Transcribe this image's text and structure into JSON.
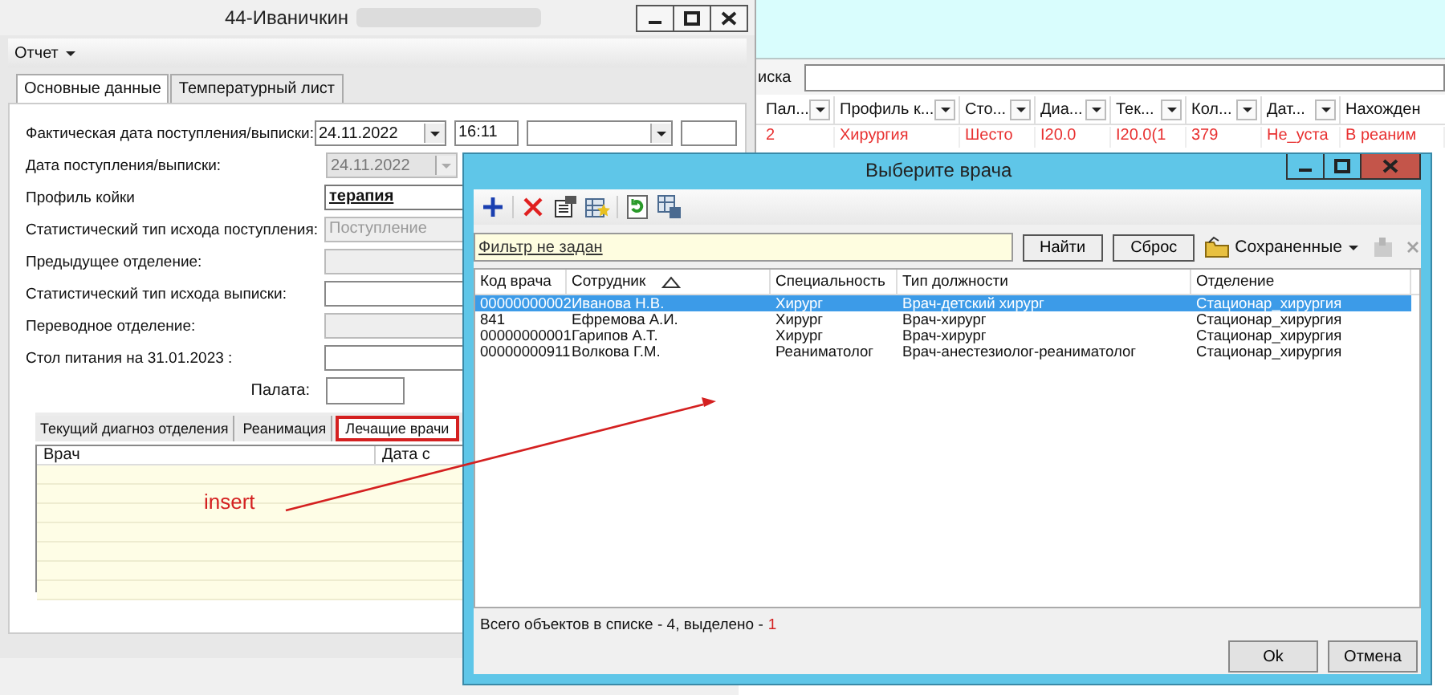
{
  "background_app": {
    "search_label": "иска",
    "columns": [
      {
        "label": "Пал..."
      },
      {
        "label": "Профиль к..."
      },
      {
        "label": "Сто..."
      },
      {
        "label": "Диа..."
      },
      {
        "label": "Тек..."
      },
      {
        "label": "Кол..."
      },
      {
        "label": "Дат..."
      },
      {
        "label": "Нахожден"
      }
    ],
    "rows": [
      {
        "cells": [
          "2",
          "Хирургия",
          "Шесто",
          "I20.0",
          "I20.0(1",
          "379",
          "Не_уста",
          "В реаним"
        ]
      }
    ]
  },
  "patient_window": {
    "title": "44-Иваничкин",
    "menu": [
      {
        "label": "Отчет"
      }
    ],
    "tabs": [
      {
        "label": "Основные данные",
        "selected": true
      },
      {
        "label": "Температурный лист",
        "selected": false
      }
    ],
    "fields": [
      {
        "label": "Фактическая дата поступления/выписки:",
        "controls": [
          {
            "kind": "combo",
            "value": "24.11.2022",
            "disabled": false
          },
          {
            "kind": "text",
            "value": "16:11",
            "disabled": false
          },
          {
            "kind": "combo",
            "disabled": false
          },
          {
            "kind": "small",
            "disabled": false
          }
        ]
      },
      {
        "label": "Дата поступления/выписки:",
        "controls": [
          {
            "kind": "combo",
            "value": "24.11.2022",
            "disabled": true
          }
        ]
      },
      {
        "label": "Профиль койки",
        "controls": [
          {
            "kind": "link",
            "value": "терапия"
          }
        ]
      },
      {
        "label": "Статистический тип исхода поступления:",
        "controls": [
          {
            "kind": "wide",
            "value": "Поступление",
            "disabled": true
          }
        ]
      },
      {
        "label": "Предыдущее отделение:",
        "controls": [
          {
            "kind": "wide",
            "disabled": true
          }
        ]
      },
      {
        "label": "Статистический тип исхода выписки:",
        "controls": [
          {
            "kind": "wide",
            "disabled": false
          }
        ]
      },
      {
        "label": "Переводное отделение:",
        "controls": [
          {
            "kind": "wide",
            "disabled": true
          }
        ]
      },
      {
        "label": "Стол питания на 31.01.2023 :",
        "controls": [
          {
            "kind": "wide",
            "disabled": false
          }
        ]
      }
    ],
    "ward": {
      "label": "Палата:"
    },
    "subtabs": [
      {
        "label": "Текущий диагноз отделения",
        "selected": false,
        "highlighted": false
      },
      {
        "label": "Реанимация",
        "selected": false,
        "highlighted": false
      },
      {
        "label": "Лечащие врачи",
        "selected": true,
        "highlighted": true
      }
    ],
    "grid_columns": [
      "Врач",
      "Дата с"
    ]
  },
  "annotation": {
    "text": "insert"
  },
  "dialog": {
    "title": "Выберите врача",
    "filter_link": "Фильтр не задан",
    "buttons": [
      {
        "label": "Найти"
      },
      {
        "label": "Сброс"
      }
    ],
    "saved": "Сохраненные",
    "columns": [
      {
        "label": "Код врача"
      },
      {
        "label": "Сотрудник",
        "sorted": true
      },
      {
        "label": "Специальность"
      },
      {
        "label": "Тип должности"
      },
      {
        "label": "Отделение"
      }
    ],
    "rows": [
      {
        "cells": [
          "00000000002",
          "Иванова Н.В.",
          "Хирург",
          "Врач-детский хирург",
          "Стационар_хирургия"
        ],
        "selected": true
      },
      {
        "cells": [
          "841",
          "Ефремова А.И.",
          "Хирург",
          "Врач-хирург",
          "Стационар_хирургия"
        ],
        "selected": false
      },
      {
        "cells": [
          "00000000001",
          "Гарипов А.Т.",
          "Хирург",
          "Врач-хирург",
          "Стационар_хирургия"
        ],
        "selected": false
      },
      {
        "cells": [
          "00000000911",
          "Волкова Г.М.",
          "Реаниматолог",
          "Врач-анестезиолог-реаниматолог",
          "Стационар_хирургия"
        ],
        "selected": false
      }
    ],
    "status_text": "Всего объектов в списке - 4, выделено -",
    "status_count": "1",
    "footer_buttons": [
      {
        "label": "Ok"
      },
      {
        "label": "Отмена"
      }
    ]
  }
}
